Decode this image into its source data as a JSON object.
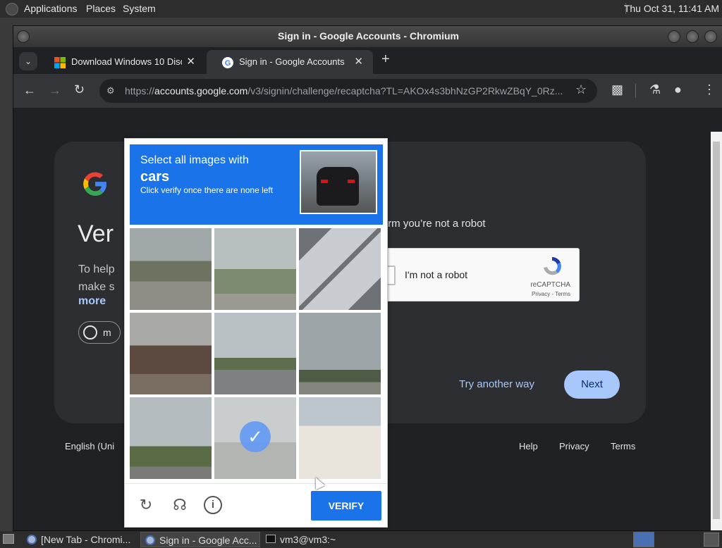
{
  "desktop": {
    "menu": [
      "Applications",
      "Places",
      "System"
    ],
    "clock": "Thu Oct 31, 11:41 AM"
  },
  "window": {
    "title": "Sign in - Google Accounts - Chromium",
    "tabs": [
      {
        "label": "Download Windows 10 Disc",
        "icon": "windows-logo-icon",
        "active": false
      },
      {
        "label": "Sign in - Google Accounts",
        "icon": "google-icon",
        "active": true
      }
    ],
    "new_tab": "+",
    "url_scheme": "https://",
    "url_host": "accounts.google.com",
    "url_path": "/v3/signin/challenge/recaptcha?TL=AKOx4s3bhNzGP2RkwZBqY_0Rz..."
  },
  "signin": {
    "heading": "Ver",
    "help_line1": "To help",
    "help_line2": "make s",
    "more": "more",
    "chip_text": "m",
    "robot_text": "onfirm you’re not a robot",
    "checkbox_label": "I'm not a robot",
    "recaptcha_brand": "reCAPTCHA",
    "privacy_terms": "Privacy - Terms",
    "try_another": "Try another way",
    "next": "Next",
    "language": "English (Uni",
    "footer": [
      "Help",
      "Privacy",
      "Terms"
    ]
  },
  "captcha": {
    "prompt_line1": "Select all images with",
    "target": "cars",
    "instruction": "Click verify once there are none left",
    "verify": "VERIFY",
    "selected_tile": 8,
    "tile_count": 9,
    "controls": [
      "reload-icon",
      "audio-icon",
      "info-icon"
    ],
    "accent_color": "#1a73e8"
  },
  "taskbar": {
    "items": [
      "[New Tab - Chromi...",
      "Sign in - Google Acc...",
      "vm3@vm3:~"
    ]
  }
}
